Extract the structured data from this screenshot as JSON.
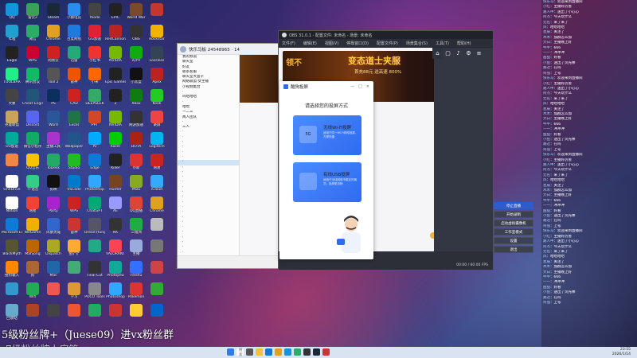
{
  "desktop": {
    "icons": [
      {
        "label": "QQ",
        "color": "#1296db"
      },
      {
        "label": "雷云2",
        "color": "#3aa05a"
      },
      {
        "label": "Steam",
        "color": "#1b2838"
      },
      {
        "label": "小鹅电竞",
        "color": "#2b8cf0"
      },
      {
        "label": "Yoodo",
        "color": "#444"
      },
      {
        "label": "EPIC",
        "color": "#222"
      },
      {
        "label": "World War",
        "color": "#7a4b2a"
      },
      {
        "label": "",
        "color": "#c5362e"
      },
      {
        "label": "哔哩",
        "color": "#20a0d0"
      },
      {
        "label": "微信",
        "color": "#2aae67"
      },
      {
        "label": "Chrome",
        "color": "#e0a020"
      },
      {
        "label": "百度网盘",
        "color": "#1f7ae0"
      },
      {
        "label": "GG加速",
        "color": "#d23"
      },
      {
        "label": "RedCannon",
        "color": "#b22"
      },
      {
        "label": "OBS",
        "color": "#333"
      },
      {
        "label": "Rockstar",
        "color": "#f3b200"
      },
      {
        "label": "Eagle",
        "color": "#222"
      },
      {
        "label": "WPS",
        "color": "#c03"
      },
      {
        "label": "网易云",
        "color": "#c22"
      },
      {
        "label": "迅雷",
        "color": "#2a7"
      },
      {
        "label": "小红书",
        "color": "#e33"
      },
      {
        "label": "NVIDIA",
        "color": "#76b900"
      },
      {
        "label": "iQIYI",
        "color": "#1a1"
      },
      {
        "label": "Lossless",
        "color": "#345"
      },
      {
        "label": "TOOLBAR",
        "color": "#2e8"
      },
      {
        "label": "腾讯会议",
        "color": "#1b6"
      },
      {
        "label": "Tool 2",
        "color": "#555"
      },
      {
        "label": "雷神",
        "color": "#e50"
      },
      {
        "label": "小米",
        "color": "#f60"
      },
      {
        "label": "Epic Games",
        "color": "#222"
      },
      {
        "label": "小黑盒",
        "color": "#111"
      },
      {
        "label": "Apex",
        "color": "#b22"
      },
      {
        "label": "大象",
        "color": "#444"
      },
      {
        "label": "Cheat Engine",
        "color": "#257"
      },
      {
        "label": "PS",
        "color": "#0b2f5e"
      },
      {
        "label": "CAD",
        "color": "#c22"
      },
      {
        "label": "DEEPSEEK",
        "color": "#3a6"
      },
      {
        "label": "2",
        "color": "#222"
      },
      {
        "label": "Xbox",
        "color": "#107c10"
      },
      {
        "label": "Kook",
        "color": "#2c2"
      },
      {
        "label": "英雄联盟",
        "color": "#c8a45a"
      },
      {
        "label": "Discord",
        "color": "#5865f2"
      },
      {
        "label": "Word",
        "color": "#2b579a"
      },
      {
        "label": "Excel",
        "color": "#217346"
      },
      {
        "label": "PPT",
        "color": "#d24726"
      },
      {
        "label": "NVIDIA",
        "color": "#76b900"
      },
      {
        "label": "网游加速",
        "color": "#333"
      },
      {
        "label": "录屏",
        "color": "#e44"
      },
      {
        "label": "UU加速",
        "color": "#0a9"
      },
      {
        "label": "微信小程序",
        "color": "#1a6"
      },
      {
        "label": "主播工具",
        "color": "#a3c"
      },
      {
        "label": "Wallpaper",
        "color": "#258"
      },
      {
        "label": "AI",
        "color": "#0af"
      },
      {
        "label": "Razer",
        "color": "#0c0"
      },
      {
        "label": "DOTA",
        "color": "#a21"
      },
      {
        "label": "Logitech",
        "color": "#00b4f0"
      },
      {
        "label": "",
        "color": "#e84"
      },
      {
        "label": "QQ音乐",
        "color": "#f5c400"
      },
      {
        "label": "ToDesk",
        "color": "#2a6"
      },
      {
        "label": "Studio",
        "color": "#2b2"
      },
      {
        "label": "Edge",
        "color": "#0d7ad6"
      },
      {
        "label": "Killer",
        "color": "#222"
      },
      {
        "label": "奈斯",
        "color": "#d33"
      },
      {
        "label": "网易",
        "color": "#c22"
      },
      {
        "label": "OneDrive",
        "color": "#fff"
      },
      {
        "label": "TT语音",
        "color": "#3c8"
      },
      {
        "label": "剪映",
        "color": "#111"
      },
      {
        "label": "VSCode",
        "color": "#007acc"
      },
      {
        "label": "Photoshop",
        "color": "#31a8ff"
      },
      {
        "label": "Hunter",
        "color": "#742"
      },
      {
        "label": "Mizu",
        "color": "#8a2"
      },
      {
        "label": "iCloud",
        "color": "#3af"
      },
      {
        "label": "Notion",
        "color": "#fff"
      },
      {
        "label": "网易",
        "color": "#e43"
      },
      {
        "label": "Party",
        "color": "#a2c"
      },
      {
        "label": "WPS",
        "color": "#c22"
      },
      {
        "label": "ChatGPT",
        "color": "#0a7"
      },
      {
        "label": "AE",
        "color": "#9999ff"
      },
      {
        "label": "QQ直播",
        "color": "#d43"
      },
      {
        "label": "Chrome",
        "color": "#e0a020"
      },
      {
        "label": "Microsoft Edge",
        "color": "#0d7ad6"
      },
      {
        "label": "WeGame",
        "color": "#f0b000"
      },
      {
        "label": "风暴英雄",
        "color": "#3366cc"
      },
      {
        "label": "雷神",
        "color": "#c33"
      },
      {
        "label": "Dread Hunger",
        "color": "#556"
      },
      {
        "label": "KK",
        "color": "#333"
      },
      {
        "label": "三角洲",
        "color": "#2a4"
      },
      {
        "label": "",
        "color": "#bbb"
      },
      {
        "label": "BlackMyth",
        "color": "#553"
      },
      {
        "label": "Mahjong",
        "color": "#b60"
      },
      {
        "label": "Dispatch",
        "color": "#aa2"
      },
      {
        "label": "金铲铲",
        "color": "#fa3"
      },
      {
        "label": "",
        "color": "#2a8"
      },
      {
        "label": "VALORANT",
        "color": "#fa4454"
      },
      {
        "label": "主播",
        "color": "#9ad"
      },
      {
        "label": "",
        "color": "#777"
      },
      {
        "label": "搜狗输入",
        "color": "#f80"
      },
      {
        "label": "狗",
        "color": "#a63"
      },
      {
        "label": "Mac",
        "color": "#26a"
      },
      {
        "label": "",
        "color": "#4a7"
      },
      {
        "label": "Final Cut",
        "color": "#333"
      },
      {
        "label": "Photopea",
        "color": "#1a9"
      },
      {
        "label": "Feishu",
        "color": "#3370ff"
      },
      {
        "label": "",
        "color": "#c44"
      },
      {
        "label": "",
        "color": "#39c"
      },
      {
        "label": "Wifi",
        "color": "#2a5"
      },
      {
        "label": "",
        "color": "#e55"
      },
      {
        "label": "学习",
        "color": "#d93"
      },
      {
        "label": "POCO Tools",
        "color": "#888"
      },
      {
        "label": "Photoshop",
        "color": "#31a8ff"
      },
      {
        "label": "Pokémon",
        "color": "#d33"
      },
      {
        "label": "",
        "color": "#3a3"
      },
      {
        "label": "回收站",
        "color": "#6ac"
      },
      {
        "label": "",
        "color": "#a42"
      },
      {
        "label": "",
        "color": "#444"
      },
      {
        "label": "",
        "color": "#e53"
      },
      {
        "label": "",
        "color": "#2a6"
      },
      {
        "label": "",
        "color": "#c33"
      },
      {
        "label": "",
        "color": "#fc3"
      },
      {
        "label": "",
        "color": "#06c"
      }
    ]
  },
  "chat_window": {
    "title": "快乐马板 24548965 · 14",
    "items": [
      "我的频道",
      "聊天室",
      "好友",
      "联系客服",
      "聊天室大盒子",
      "网络联盟·女主播",
      "小视频集合",
      "·",
      "吗哈哈哈",
      "·",
      "哈哈",
      "一二三",
      "两人团队",
      "·",
      "三人",
      "·",
      "·",
      "·",
      "·",
      "·",
      "·",
      "·",
      "·",
      "·",
      "·",
      "·",
      "·",
      "·",
      "·",
      "·",
      "·",
      "·",
      "·",
      "·",
      "·",
      "·",
      "·",
      "·",
      "·",
      "·",
      "·"
    ]
  },
  "obs": {
    "title": "OBS 31.0.1 - 配置文件: 未命名 - 场景: 未命名",
    "menus": [
      "文件(F)",
      "编辑(E)",
      "视图(V)",
      "停靠窗口(D)",
      "配置文件(P)",
      "场景集合(S)",
      "工具(T)",
      "帮助(H)"
    ],
    "banner_left": "领不",
    "banner_title": "变态道士夹服",
    "banner_sub": "首充88元 送高速 800%",
    "side_buttons": [
      "停止直播",
      "开始录制",
      "启动虚拟摄像机",
      "工作室模式",
      "设置",
      "退出"
    ],
    "status": "00:00 / 60.00 FPS"
  },
  "dialog": {
    "title": "酷狗投屏",
    "heading": "请选择您的投屏方式",
    "wifi": {
      "title": "无线Wi-Fi投屏",
      "desc": "适用于同一Wi-Fi网络投屏，方便快捷",
      "icon": "5G"
    },
    "usb": {
      "title": "有线USB投屏",
      "desc": "适用于无线网络不稳定的情况，投屏更流畅"
    }
  },
  "right_panel": {
    "messages": [
      {
        "user": "快乐马",
        "text": "欢迎来到直播间"
      },
      {
        "user": "小红",
        "text": "主播好厉害"
      },
      {
        "user": "路人甲",
        "text": "送出了小心心"
      },
      {
        "user": "阿杰",
        "text": "今天玩什么"
      },
      {
        "user": "无名",
        "text": "来了来了"
      },
      {
        "user": "风",
        "text": "哈哈哈哈"
      },
      {
        "user": "星辰",
        "text": "关注了"
      },
      {
        "user": "木木",
        "text": "加群怎么加"
      },
      {
        "user": "大白",
        "text": "主播晚上好"
      },
      {
        "user": "牛牛",
        "text": "666"
      },
      {
        "user": "一一",
        "text": "冲冲冲"
      },
      {
        "user": "甜甜",
        "text": "好看"
      },
      {
        "user": "小鱼",
        "text": "送出了荧光棒"
      },
      {
        "user": "路过",
        "text": "在吗"
      },
      {
        "user": "阿强",
        "text": "上号"
      }
    ]
  },
  "overlay": {
    "line1": "5级粉丝牌+（Juese09）进vx粉丝群",
    "line2": "7级粉丝牌上房管"
  },
  "taskbar": {
    "search_placeholder": "搜索",
    "time": "23:55",
    "date": "2026/1/14"
  }
}
